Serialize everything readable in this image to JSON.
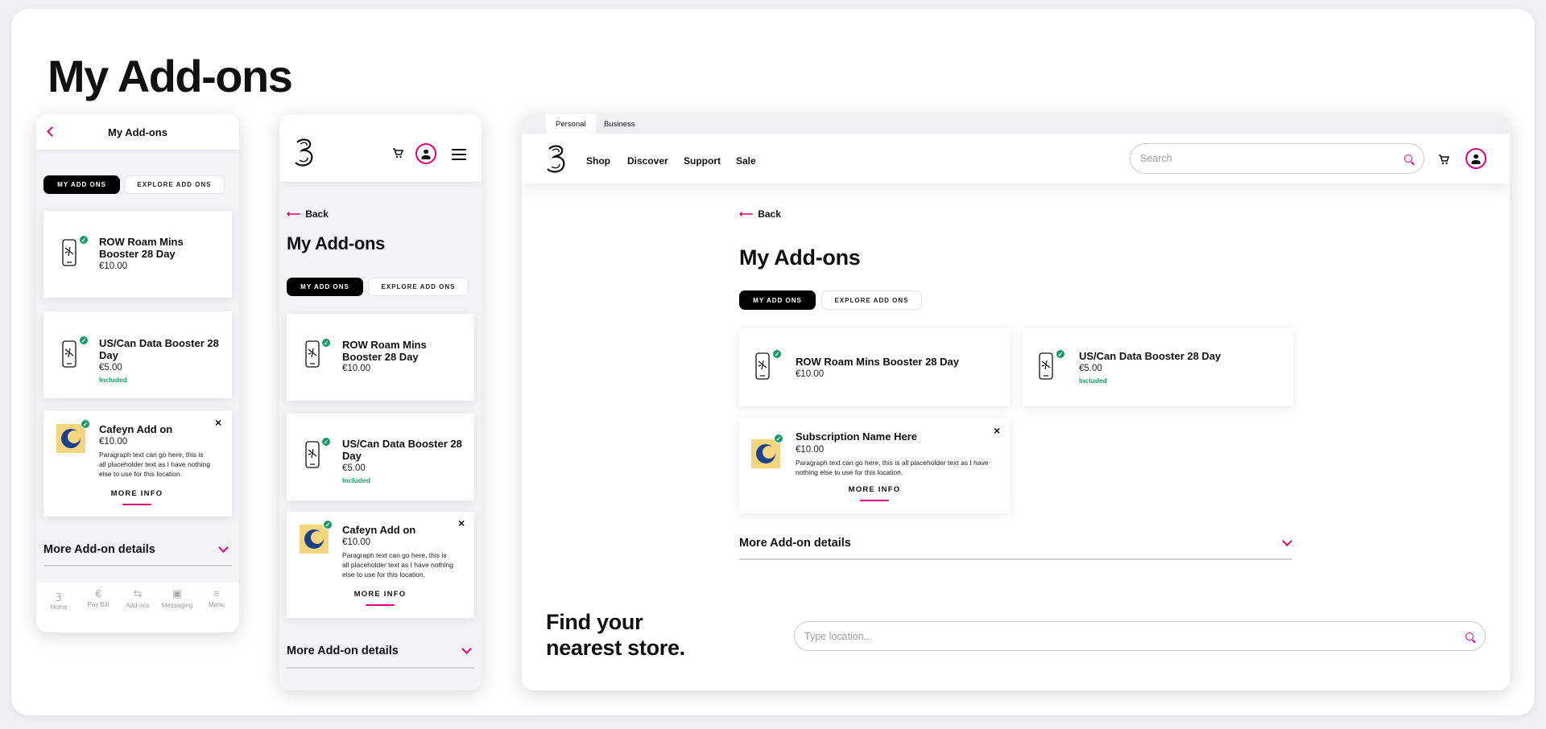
{
  "page_title": "My Add-ons",
  "colors": {
    "accent": "#e0007a",
    "included": "#1a9b6b",
    "check": "#179a67"
  },
  "mobile_app": {
    "header_title": "My Add-ons",
    "back_icon": "chevron-left-icon",
    "tabs": {
      "my": "MY ADD ONS",
      "explore": "EXPLORE ADD ONS"
    },
    "cards": [
      {
        "title": "ROW Roam Mins Booster 28 Day",
        "price": "€10.00"
      },
      {
        "title": "US/Can Data Booster 28 Day",
        "price": "€5.00",
        "status": "Included"
      },
      {
        "title": "Cafeyn Add on",
        "price": "€10.00",
        "paragraph": "Paragraph text can go here, this is all placeholder text as I have nothing else to use for this location.",
        "more": "MORE INFO",
        "close": "×"
      }
    ],
    "details_label": "More Add-on details",
    "bottom_tabs": [
      {
        "label": "Home",
        "icon": "three-logo-icon"
      },
      {
        "label": "Pay Bill",
        "icon": "euro-icon"
      },
      {
        "label": "Add-ons",
        "icon": "addons-icon"
      },
      {
        "label": "Messaging",
        "icon": "message-icon"
      },
      {
        "label": "Menu",
        "icon": "menu-icon"
      }
    ]
  },
  "mobile_web": {
    "back_label": "Back",
    "title": "My Add-ons",
    "tabs": {
      "my": "MY ADD ONS",
      "explore": "EXPLORE ADD ONS"
    },
    "cards": [
      {
        "title": "ROW Roam Mins Booster 28 Day",
        "price": "€10.00"
      },
      {
        "title": "US/Can Data Booster 28 Day",
        "price": "€5.00",
        "status": "Included"
      },
      {
        "title": "Cafeyn Add on",
        "price": "€10.00",
        "paragraph": "Paragraph text can go here, this is all placeholder text as I have nothing else to use for this location.",
        "more": "MORE INFO",
        "close": "×"
      }
    ],
    "details_label": "More Add-on details"
  },
  "desktop": {
    "top_tabs": [
      "Personal",
      "Business"
    ],
    "nav": [
      "Shop",
      "Discover",
      "Support",
      "Sale"
    ],
    "search_placeholder": "Search",
    "back_label": "Back",
    "title": "My Add-ons",
    "tabs": {
      "my": "MY ADD ONS",
      "explore": "EXPLORE ADD ONS"
    },
    "cards": [
      {
        "title": "ROW Roam Mins Booster 28 Day",
        "price": "€10.00"
      },
      {
        "title": "US/Can Data Booster 28 Day",
        "price": "€5.00",
        "status": "Included"
      },
      {
        "title": "Subscription Name Here",
        "price": "€10.00",
        "paragraph": "Paragraph text can go here, this is all placeholder text as I have nothing else to use for this location.",
        "more": "MORE INFO",
        "close": "×"
      }
    ],
    "details_label": "More Add-on details",
    "store_heading": "Find your nearest store.",
    "location_placeholder": "Type location..."
  }
}
